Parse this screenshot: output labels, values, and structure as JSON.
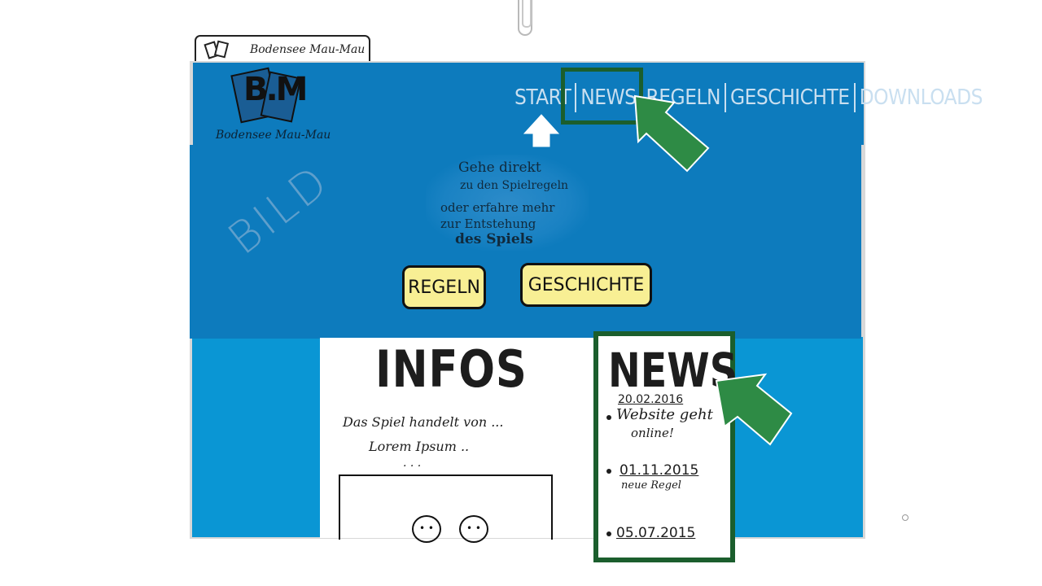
{
  "browser_tab": {
    "title": "Bodensee Mau-Mau"
  },
  "header": {
    "logo_letters": "B.M",
    "logo_text": "Bodensee  Mau-Mau",
    "nav": [
      {
        "label": "START"
      },
      {
        "label": "NEWS"
      },
      {
        "label": "REGELN"
      },
      {
        "label": "GESCHICHTE"
      },
      {
        "label": "DOWNLOADS"
      }
    ]
  },
  "hero": {
    "image_placeholder": "BILD",
    "text_lines": [
      "Gehe direkt",
      "zu den Spielregeln",
      "oder erfahre mehr",
      "zur Entstehung",
      "des Spiels"
    ],
    "buttons": {
      "regeln": "REGELN",
      "geschichte": "GESCHICHTE"
    }
  },
  "infos": {
    "heading": "INFOS",
    "lines": [
      "Das Spiel handelt von ...",
      "Lorem  Ipsum  ..",
      ". . ."
    ]
  },
  "news": {
    "heading": "NEWS",
    "items": [
      {
        "date": "20.02.2016",
        "text": "Website geht",
        "text2": "online!"
      },
      {
        "date": "01.11.2015",
        "text": "neue Regel"
      },
      {
        "date": "05.07.2015"
      }
    ]
  },
  "colors": {
    "header_blue": "#0d7bbd",
    "page_blue": "#0a96d4",
    "button_yellow": "#f8ef94",
    "highlight_green": "#1b5e2d",
    "arrow_green": "#2e8b45"
  },
  "icons": [
    "cards-icon",
    "paper-clip-icon",
    "up-arrow-icon",
    "green-arrow-icon"
  ]
}
